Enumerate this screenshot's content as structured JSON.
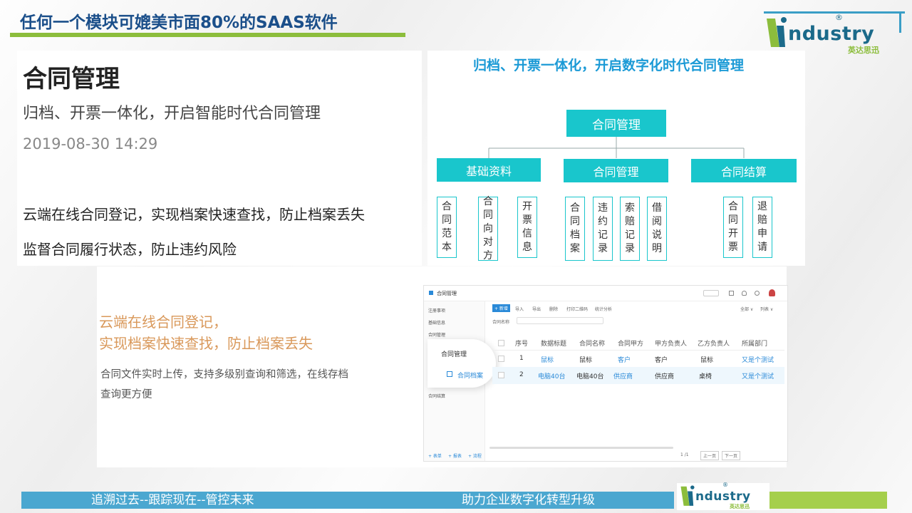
{
  "header": {
    "title": "任何一个模块可媲美市面80%的SAAS软件"
  },
  "logo": {
    "word": "ndustry",
    "sub": "英达思迅",
    "reg": "®",
    "colors": {
      "blue": "#1b6a8a",
      "green": "#8cbd3c"
    }
  },
  "article": {
    "title": "合同管理",
    "subtitle": "归档、开票一体化，开启智能时代合同管理",
    "date": "2019-08-30 14:29",
    "line1": "云端在线合同登记，实现档案快速查找，防止档案丢失",
    "line2": "监督合同履行状态，防止违约风险"
  },
  "diagram": {
    "heading": "归档、开票一体化，开启数字化时代合同管理",
    "root": "合同管理",
    "groups": [
      {
        "label": "基础资料",
        "leaves": [
          "合同范本",
          "合同向对方",
          "开票信息"
        ]
      },
      {
        "label": "合同管理",
        "leaves": [
          "合同档案",
          "违约记录",
          "索赔记录",
          "借阅说明"
        ]
      },
      {
        "label": "合同结算",
        "leaves": [
          "合同开票",
          "退赔申请"
        ]
      }
    ],
    "accent": "#19c6cc"
  },
  "lower": {
    "head1": "云端在线合同登记，",
    "head2": "实现档案快速查找，防止档案丢失",
    "desc1": "合同文件实时上传，支持多级别查询和筛选，在线存档",
    "desc2": "查询更方便"
  },
  "app": {
    "title": "合同管理",
    "sidebar": [
      "注册事项",
      "基础信息",
      "合同管理",
      "合同结算"
    ],
    "bubble": {
      "item1": "合同管理",
      "item2": "合同档案"
    },
    "toolbar": [
      "+ 新增",
      "导入",
      "导出",
      "删除",
      "打印二维码",
      "统计分析"
    ],
    "filter": [
      "全部 ∨",
      "列表 ∨"
    ],
    "search_label": "合同名称",
    "columns": [
      "序号",
      "数据标题",
      "合同名称",
      "合同甲方",
      "甲方负责人",
      "乙方负责人",
      "所属部门"
    ],
    "rows": [
      [
        "1",
        "鼠标",
        "鼠标",
        "客户",
        "客户",
        "鼠标",
        "又是个测试"
      ],
      [
        "2",
        "电脑40台",
        "电脑40台",
        "供应商",
        "供应商",
        "桌椅",
        "又是个测试"
      ]
    ],
    "footer_left": [
      "+ 表单",
      "+ 报表",
      "+ 流程"
    ],
    "pager": [
      "1 /1",
      "上一页",
      "下一页"
    ]
  },
  "footer": {
    "left": "追溯过去--跟踪现在--管控未来",
    "right": "助力企业数字化转型升级"
  }
}
